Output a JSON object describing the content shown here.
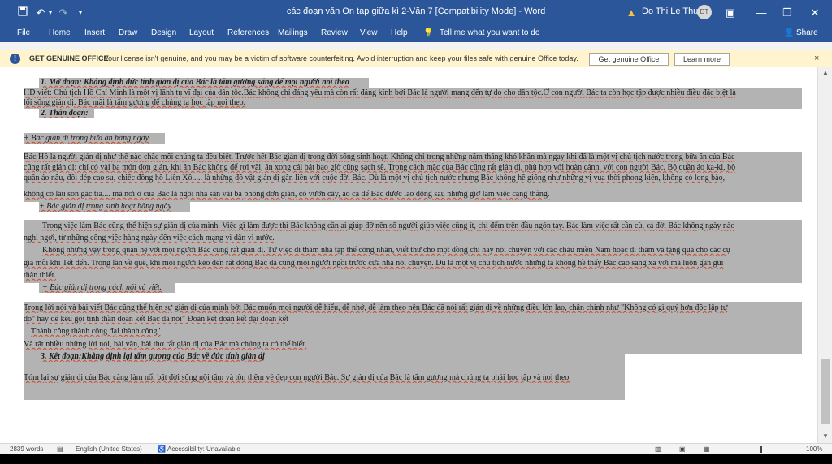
{
  "window": {
    "title": "các đoạn văn On tap giữa kì 2-Văn 7 [Compatibility Mode]  -  Word",
    "user_name": "Do Thi Le Thuy",
    "user_initials": "DT"
  },
  "quick_access": {
    "save_icon": "save-icon",
    "undo_icon": "undo-icon",
    "redo_icon": "redo-icon"
  },
  "menu": {
    "items": [
      "File",
      "Home",
      "Insert",
      "Draw",
      "Design",
      "Layout",
      "References",
      "Mailings",
      "Review",
      "View",
      "Help"
    ],
    "tell_me": "Tell me what you want to do",
    "share": "Share"
  },
  "message_bar": {
    "title": "GET GENUINE OFFICE",
    "text": "Your license isn't genuine, and you may be a victim of software counterfeiting. Avoid interruption and keep your files safe with genuine Office today.",
    "get_button": "Get genuine Office",
    "learn_button": "Learn more",
    "close": "×"
  },
  "document": {
    "lines": [
      "1. Mở đoạn: Khẳng định đức tính giản dị của Bác là tấm gương sáng để mọi người noi theo",
      "HD viết: Chủ tịch Hồ Chí Minh là một vị lãnh tụ vĩ đại của dân tộc.Bác không chỉ đáng yêu mà còn rất đáng kính bởi Bác là người mang đến tự do cho dân tộc.Ở con người Bác ta còn học tập được nhiều điều đặc biệt là",
      "lối sống giản dị. Bác mãi là tấm gương để chúng ta học tập noi theo.",
      "2. Thân đoạn:",
      "+  Bác giản dị trong bữa ăn hàng ngày",
      "Bác Hồ là người giản dị như thế nào chắc mỗi chúng ta đều biết. Trước hết Bác giản dị trong đời sống sinh hoạt. Không chỉ trong những năm tháng khó khăn mà ngay khi đã là một vị chủ tịch nước trong bữa ăn của Bác",
      "cũng rất giản dị: chỉ có vài ba món đơn giản, khi ăn Bác không để rơi vãi, ăn xong cái bát bao giờ cũng sạch sẽ. Trong cách mặc của Bác cũng rất giản dị, phù hợp với hoàn cảnh, với con người Bác.  Bộ quần áo ka-ki, bộ",
      "quần áo nâu, đôi dép cao su, chiếc đồng hồ Liên Xô..... là những đồ vật giản dị gắn liền với cuộc đời Bác. Dù là một vị chủ tịch nước nhưng Bác không hề giống như những vị vua thời phong kiến, không có long bào,",
      "không có lầu son gác tía.... mà nơi ở của Bác là ngôi nhà sàn vài ba phòng đơn giản, có vườn cây, ao cá để Bác được lao động sau những giờ làm việc căng thẳng.",
      "+ Bác giản dị trong sinh hoạt  hàng ngày",
      "Trong việc làm Bác cũng thể hiện sự giản dị của mình. Việc gì làm được thì Bác không cần ai giúp đỡ nên số người giúp việc cũng ít, chỉ đếm trên đầu ngón tay. Bác làm việc rất cần cù, cả đời Bác không ngày nào",
      "nghỉ ngơi, từ những công việc hàng ngày đến việc cách mạng vì dân vì nước.",
      "Không những vậy trong quan hệ với mọi người Bác cũng rất giản dị. Từ việc đi thăm nhà tập thể công nhân, viết thư cho một đồng chí hay nói chuyện với các cháu miền Nam hoặc đi thăm và tặng quà cho các cụ",
      "già mỗi khi Tết đến. Trong lần về quê, khi mọi người kéo đến rất đông Bác đã cùng mọi người ngồi trước cửa nhà nói chuyện. Dù là một vị chủ tịch nước nhưng ta không hề thấy Bác cao sang xa vời mà luôn gần gũi",
      "thân thiết.",
      "+ Bác giản dị trong cách  nói và viết.",
      "Trong lời nói và bài viết Bác cũng thể hiện sự giản dị của mình bởi Bác muốn mọi người dễ hiểu, dễ nhớ, dễ làm theo nên Bác đã nói rất giản dị về những điều lớn lao, chân chính như \"Không có gì quý hơn độc lập tự",
      "do\" hay để kêu gọi tinh thần đoàn kết Bác đã nói\" Đoàn kết đoàn kết đại đoàn kết",
      "Thành công thành công đại thành công\"",
      "Và rất nhiều những lời nói, bài văn, bài thơ rất giản dị của Bác mà chúng ta có thể biết.",
      "3. Kết đoạn:Khẳng định lại tấm gương của Bác về đức tính giản dị",
      "Tóm lại sự giản dị của Bác càng làm nổi bật đời sống nội tâm và tôn thêm vẻ đẹp con người Bác. Sự giản dị của Bác là tấm gương mà chúng ta phải học tập và noi theo."
    ]
  },
  "status_bar": {
    "words": "2839 words",
    "language": "English (United States)",
    "accessibility": "Accessibility: Unavailable",
    "zoom": "100%"
  }
}
